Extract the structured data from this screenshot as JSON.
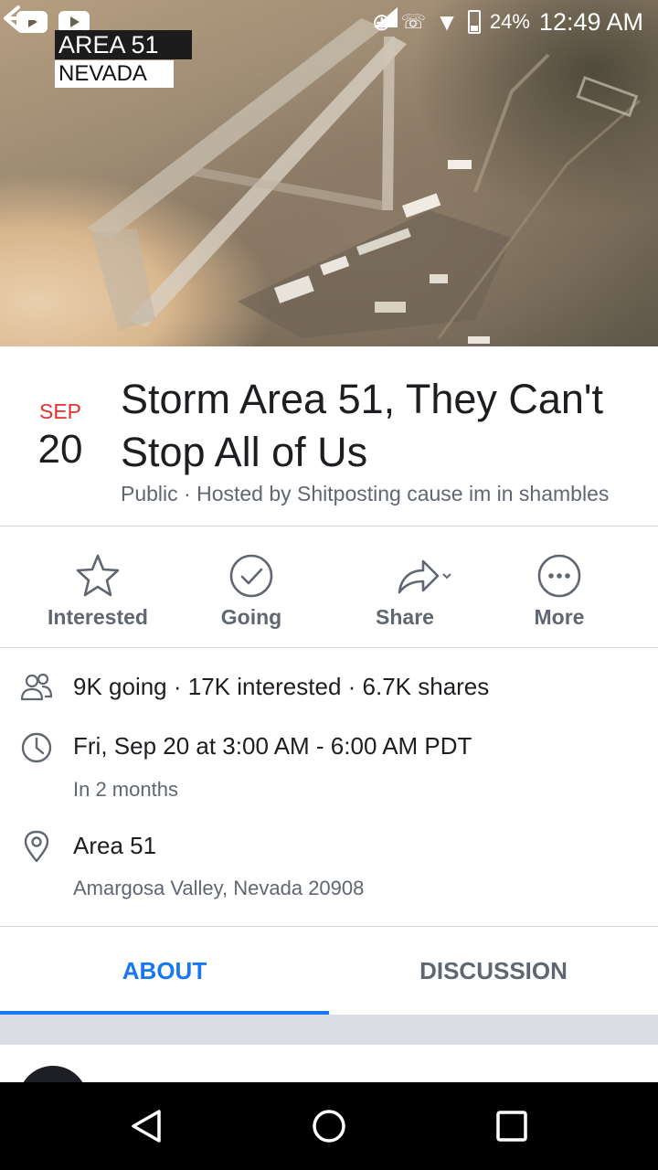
{
  "status_bar": {
    "battery_percent": "24%",
    "time": "12:49 AM",
    "left_icons": [
      "youtube-icon",
      "youtube-icon"
    ],
    "right_icons": [
      "data-saver-icon",
      "missed-call-icon",
      "wifi-icon",
      "signal-icon",
      "battery-icon"
    ]
  },
  "cover": {
    "overlay_line1": "AREA 51",
    "overlay_line2": "NEVADA",
    "back_icon": "back-arrow-icon"
  },
  "event": {
    "month": "SEP",
    "day": "20",
    "title": "Storm Area 51, They Can't Stop All of Us",
    "subtitle": "Public · Hosted by Shitposting cause im in shambles"
  },
  "actions": [
    {
      "label": "Interested",
      "icon": "star-icon"
    },
    {
      "label": "Going",
      "icon": "check-circle-icon"
    },
    {
      "label": "Share",
      "icon": "share-icon"
    },
    {
      "label": "More",
      "icon": "more-icon"
    }
  ],
  "details": {
    "stats": "9K going · 17K interested · 6.7K shares",
    "datetime": "Fri, Sep 20 at 3:00 AM - 6:00 AM PDT",
    "relative": "In 2 months",
    "location_name": "Area 51",
    "location_address": "Amargosa Valley, Nevada 20908"
  },
  "tabs": [
    {
      "label": "ABOUT",
      "active": true
    },
    {
      "label": "DISCUSSION",
      "active": false
    }
  ],
  "colors": {
    "accent": "#1877f2",
    "date_month": "#e5302e",
    "secondary_text": "#606770"
  }
}
